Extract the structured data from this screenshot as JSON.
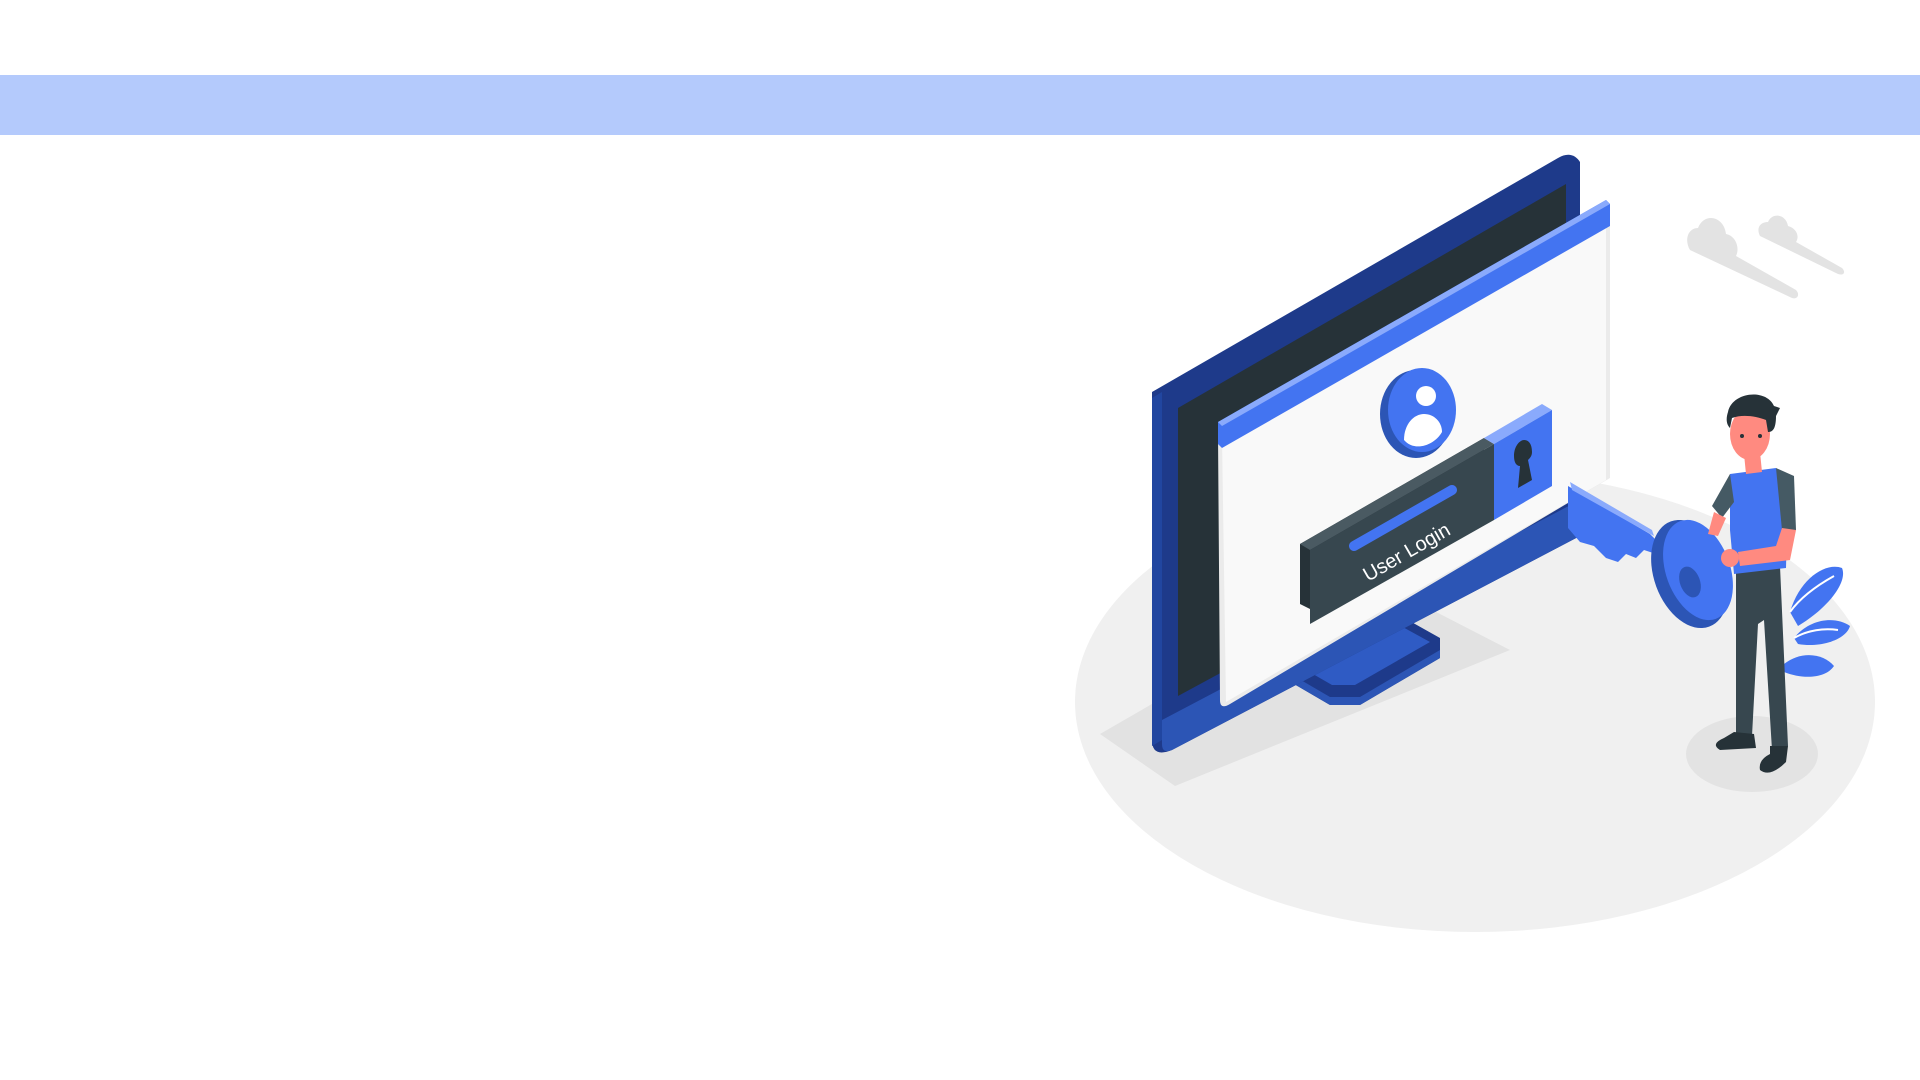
{
  "banner": {
    "color": "#b4cafc"
  },
  "illustration": {
    "login_label": "User Login",
    "icons": [
      "monitor-icon",
      "user-avatar-icon",
      "keyhole-icon",
      "key-icon",
      "cloud-icon",
      "plant-icon"
    ],
    "colors": {
      "brand_blue": "#4374f1",
      "dark_blue": "#1e3a8a",
      "screen_dark": "#263238",
      "login_bar": "#37474f",
      "ground": "#f0f0f0",
      "window": "#f9f9f9",
      "cloud": "#e3e3e3"
    }
  }
}
